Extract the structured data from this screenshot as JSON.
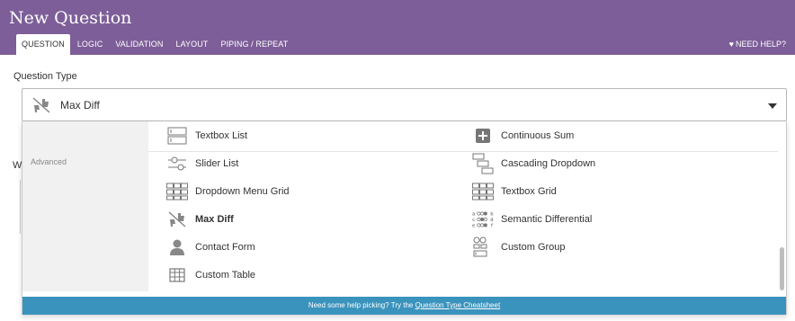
{
  "header": {
    "title": "New Question",
    "tabs": [
      {
        "label": "QUESTION",
        "active": true
      },
      {
        "label": "LOGIC",
        "active": false
      },
      {
        "label": "VALIDATION",
        "active": false
      },
      {
        "label": "LAYOUT",
        "active": false
      },
      {
        "label": "PIPING / REPEAT",
        "active": false
      }
    ],
    "help_label": "NEED HELP?",
    "help_icon": "heart-icon"
  },
  "question_type": {
    "label": "Question Type",
    "selected": "Max Diff",
    "selected_icon": "max-diff-icon"
  },
  "behind": {
    "partial_label": "W"
  },
  "dropdown": {
    "category": "Advanced",
    "items": [
      {
        "label": "Textbox List",
        "icon": "textbox-list-icon"
      },
      {
        "label": "Continuous Sum",
        "icon": "continuous-sum-icon"
      },
      {
        "label": "Slider List",
        "icon": "slider-list-icon"
      },
      {
        "label": "Cascading Dropdown",
        "icon": "cascading-dropdown-icon"
      },
      {
        "label": "Dropdown Menu Grid",
        "icon": "dropdown-menu-grid-icon"
      },
      {
        "label": "Textbox Grid",
        "icon": "textbox-grid-icon"
      },
      {
        "label": "Max Diff",
        "icon": "max-diff-icon",
        "selected": true
      },
      {
        "label": "Semantic Differential",
        "icon": "semantic-differential-icon"
      },
      {
        "label": "Contact Form",
        "icon": "contact-form-icon"
      },
      {
        "label": "Custom Group",
        "icon": "custom-group-icon"
      },
      {
        "label": "Custom Table",
        "icon": "custom-table-icon"
      }
    ],
    "footer_text": "Need some help picking? Try the",
    "footer_link": "Question Type Cheatsheet"
  },
  "colors": {
    "header": "#7d5e98",
    "footer": "#3a93bd",
    "sidebar": "#f1f1f1"
  }
}
